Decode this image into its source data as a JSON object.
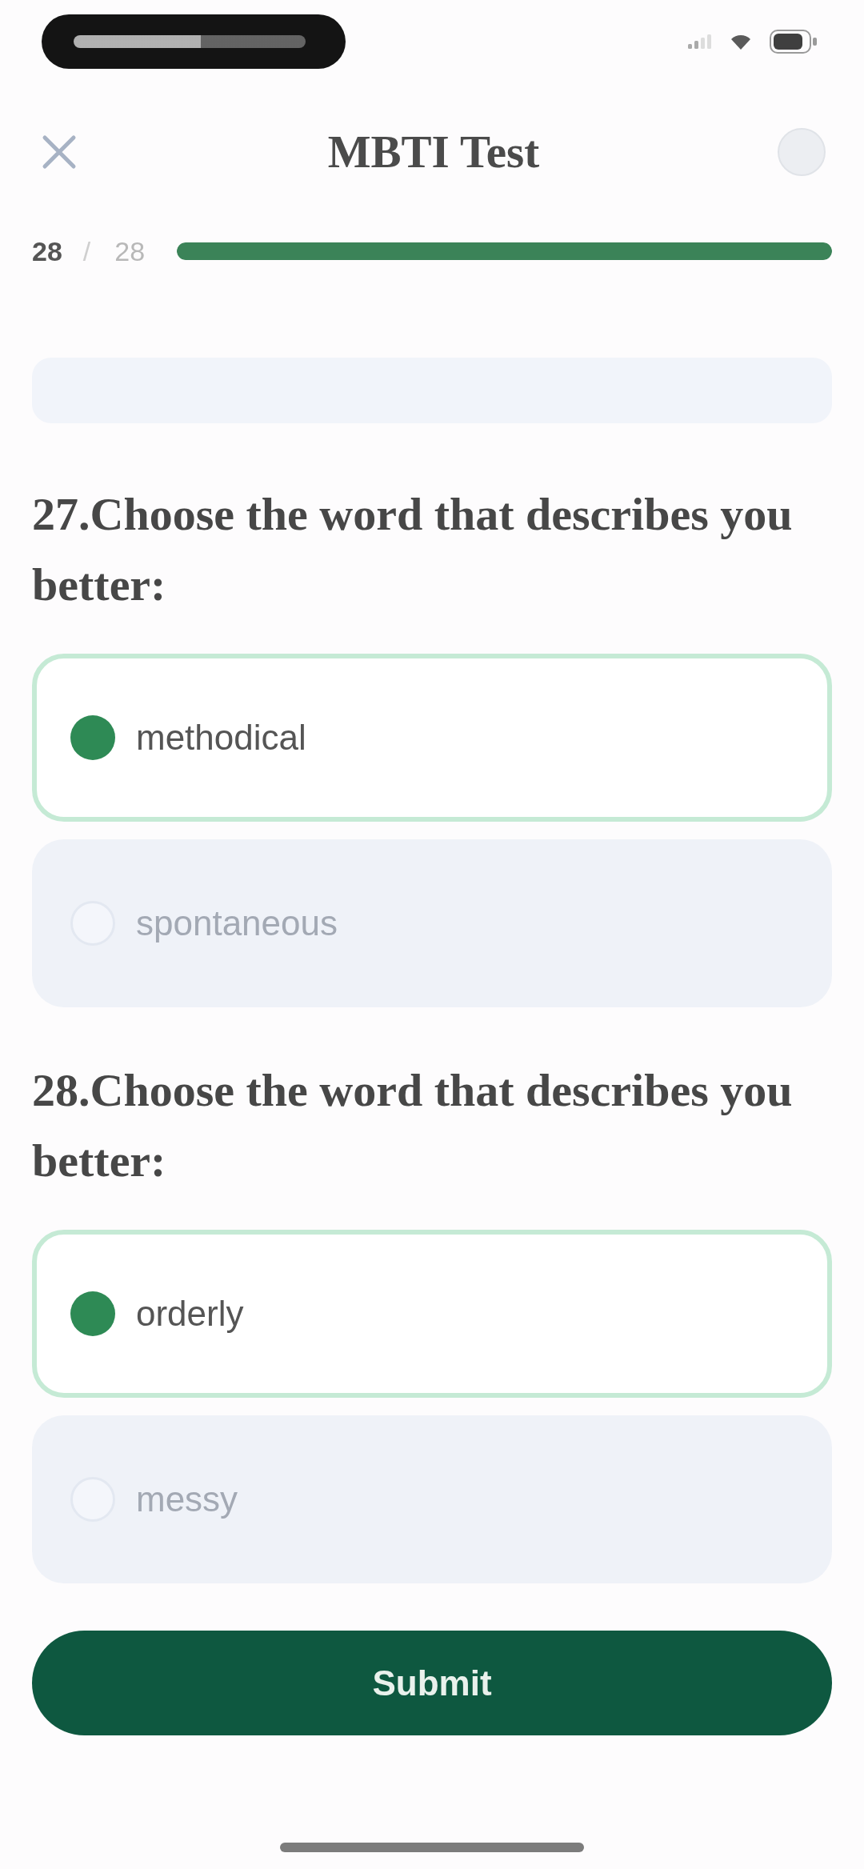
{
  "header": {
    "title": "MBTI Test"
  },
  "progress": {
    "current": "28",
    "separator": "/",
    "total": "28",
    "level": 1
  },
  "questions": [
    {
      "text": "27.Choose the word that describes you better:",
      "options": [
        {
          "label": "methodical",
          "selected": true
        },
        {
          "label": "spontaneous",
          "selected": false
        }
      ]
    },
    {
      "text": "28.Choose the word that describes you better:",
      "options": [
        {
          "label": "orderly",
          "selected": true
        },
        {
          "label": "messy",
          "selected": false
        }
      ]
    }
  ],
  "submit_button": {
    "label": "Submit"
  }
}
